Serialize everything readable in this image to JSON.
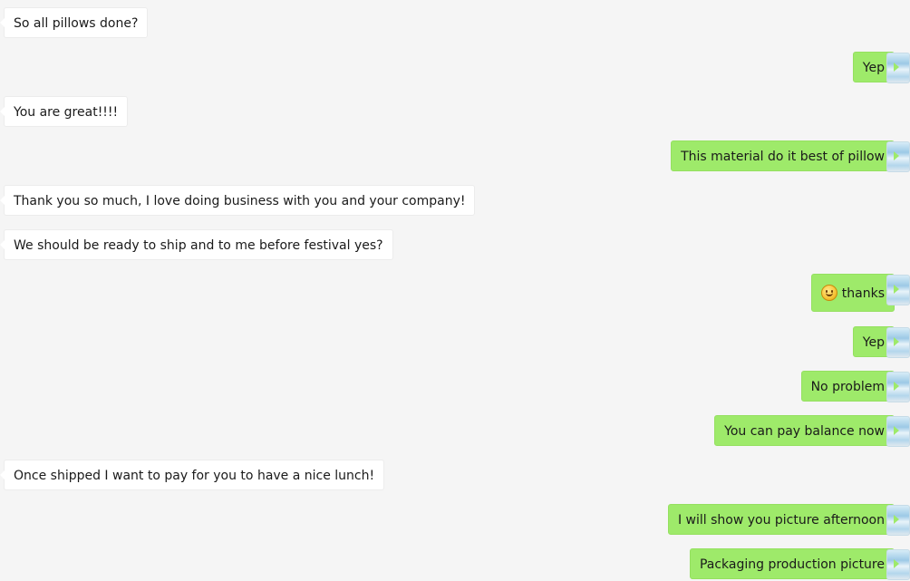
{
  "messages": [
    {
      "side": "incoming",
      "text": "So all pillows done?"
    },
    {
      "side": "outgoing",
      "text": "Yep"
    },
    {
      "side": "incoming",
      "text": "You are great!!!!"
    },
    {
      "side": "outgoing",
      "text": "This material do it best of pillow"
    },
    {
      "side": "incoming",
      "text": "Thank you so much, I love doing business with you and your company!"
    },
    {
      "side": "incoming",
      "text": "We should be ready to ship and to me before festival yes?"
    },
    {
      "side": "outgoing",
      "text": "thanks",
      "emoji": "smile-emoji-icon"
    },
    {
      "side": "outgoing",
      "text": "Yep"
    },
    {
      "side": "outgoing",
      "text": "No problem"
    },
    {
      "side": "outgoing",
      "text": "You can pay balance now"
    },
    {
      "side": "incoming",
      "text": "Once shipped I want to pay for you to have a nice lunch!"
    },
    {
      "side": "outgoing",
      "text": "I will show you picture afternoon"
    },
    {
      "side": "outgoing",
      "text": "Packaging production picture"
    }
  ],
  "colors": {
    "background": "#f5f5f5",
    "incoming_bubble": "#ffffff",
    "outgoing_bubble": "#9eea6a"
  }
}
